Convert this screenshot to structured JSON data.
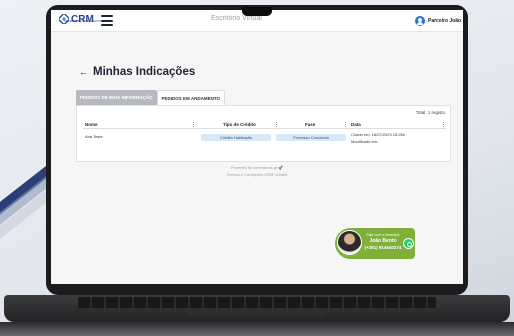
{
  "app": {
    "logo_text": "CRM",
    "logo_subtitle": "INTERMEDIAÇÃO DE CRÉDITO",
    "header_title": "Escritório Virtual",
    "user_name": "Parceiro João"
  },
  "page": {
    "title": "Minhas Indicações",
    "tabs": [
      {
        "label": "PEDIDOS DE MAIS INFORMAÇÃO",
        "active": false
      },
      {
        "label": "PEDIDOS EM ANDAMENTO",
        "active": true
      }
    ],
    "total": "Total: 1 registo"
  },
  "table": {
    "columns": [
      "Nome",
      "Tipo de Crédito",
      "Fase",
      "Data"
    ],
    "rows": [
      {
        "name": "Ana Teste",
        "credit_type": "Crédito Habitação",
        "phase": "Processo Concluído",
        "created": "Criado em: 18/07/2023 15:26h",
        "modified": "Modificado em:"
      }
    ]
  },
  "footer": {
    "powered": "Powered by commands.pt",
    "terms": "Termos e Condições CRM Crédito"
  },
  "contact": {
    "label": "Fale com o Gestor(a)",
    "name": "João Bento",
    "phone": "(+351) 914640274"
  },
  "colors": {
    "brand": "#2a3f8f",
    "pill": "#d7e8f7",
    "contact_bg": "#7fb13a",
    "whatsapp": "#25d366"
  },
  "icons": [
    "menu-icon",
    "back-arrow-icon",
    "user-avatar-icon",
    "whatsapp-icon",
    "rocket-icon"
  ]
}
